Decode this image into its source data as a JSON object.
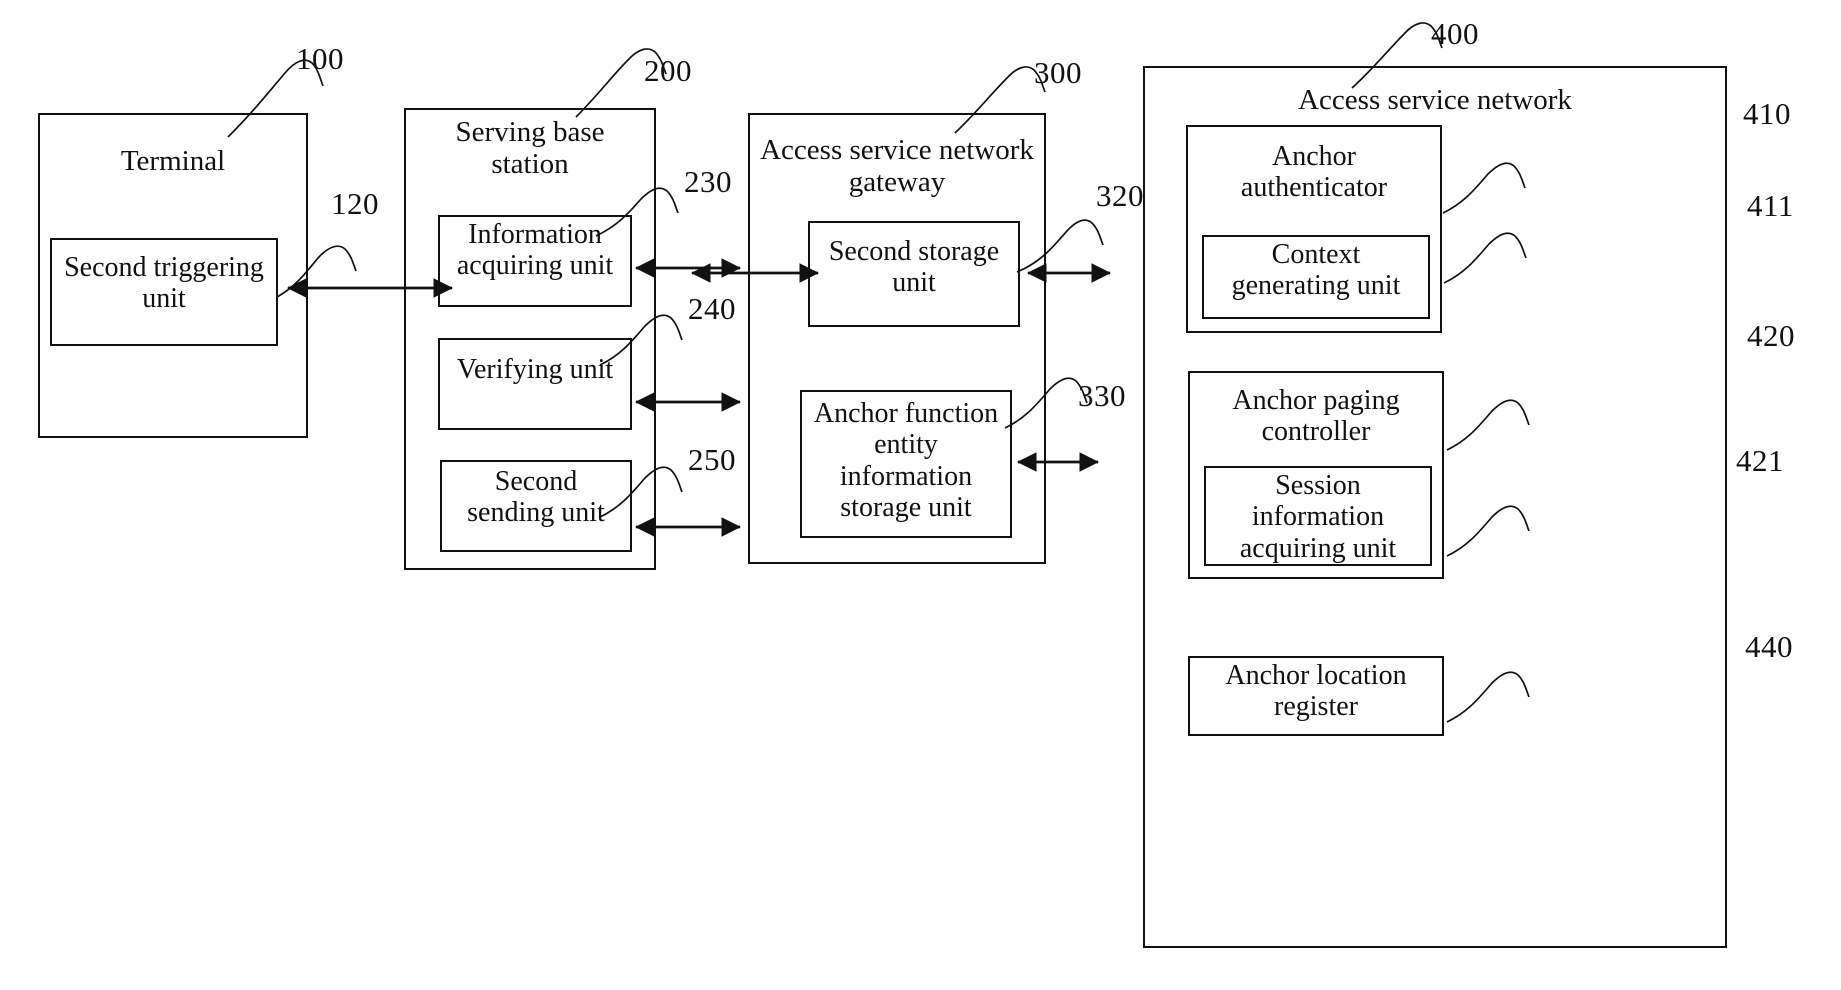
{
  "figure": {
    "type": "patent-block-diagram",
    "background": "#ffffff",
    "line_color": "#111111"
  },
  "blocks": {
    "terminal": {
      "label": "Terminal",
      "ref": "100",
      "children": {
        "second_triggering_unit": {
          "label": "Second triggering\nunit",
          "ref": "120"
        }
      }
    },
    "serving_base_station": {
      "label": "Serving base\nstation",
      "ref": "200",
      "children": {
        "information_acquiring_unit": {
          "label": "Information\nacquiring unit",
          "ref": "230"
        },
        "verifying_unit": {
          "label": "Verifying unit",
          "ref": "240"
        },
        "second_sending_unit": {
          "label": "Second\nsending unit",
          "ref": "250"
        }
      }
    },
    "access_service_network_gateway": {
      "label": "Access service network\ngateway",
      "ref": "300",
      "children": {
        "second_storage_unit": {
          "label": "Second storage\nunit",
          "ref": "320"
        },
        "anchor_function_entity_information_storage_unit": {
          "label": "Anchor function\nentity\ninformation\nstorage unit",
          "ref": "330"
        }
      }
    },
    "access_service_network": {
      "label": "Access service network",
      "ref": "400",
      "children": {
        "anchor_authenticator": {
          "label": "Anchor\nauthenticator",
          "ref": "410",
          "children": {
            "context_generating_unit": {
              "label": "Context\ngenerating unit",
              "ref": "411"
            }
          }
        },
        "anchor_paging_controller": {
          "label": "Anchor paging\ncontroller",
          "ref": "420",
          "children": {
            "session_information_acquiring_unit": {
              "label": "Session\ninformation\nacquiring unit",
              "ref": "421"
            }
          }
        },
        "anchor_location_register": {
          "label": "Anchor location\nregister",
          "ref": "440"
        }
      }
    }
  },
  "connectors": [
    {
      "name": "terminal-to-serving-base-station",
      "style": "double-arrow"
    },
    {
      "name": "information-acquiring-unit-to-gateway",
      "style": "double-arrow"
    },
    {
      "name": "serving-base-station-to-second-storage-unit",
      "style": "double-arrow"
    },
    {
      "name": "verifying-unit-outward",
      "style": "double-arrow"
    },
    {
      "name": "second-sending-unit-outward",
      "style": "double-arrow"
    },
    {
      "name": "second-storage-unit-to-access-service-network",
      "style": "double-arrow"
    },
    {
      "name": "anchor-function-entity-storage-outward",
      "style": "double-arrow"
    }
  ]
}
